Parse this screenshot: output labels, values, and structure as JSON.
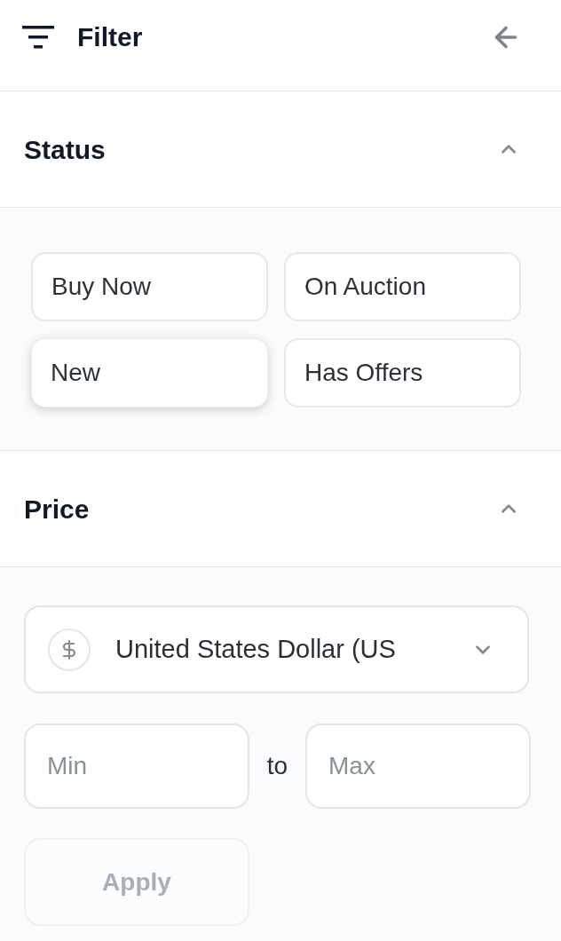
{
  "header": {
    "title": "Filter"
  },
  "sections": [
    {
      "kind": "chips",
      "title": "Status",
      "expanded": true,
      "options": [
        {
          "label": "Buy Now",
          "selected": false
        },
        {
          "label": "On Auction",
          "selected": false
        },
        {
          "label": "New",
          "selected": true
        },
        {
          "label": "Has Offers",
          "selected": false
        }
      ]
    },
    {
      "kind": "price",
      "title": "Price",
      "expanded": true,
      "currency": {
        "value": "United States Dollar (US"
      },
      "min": {
        "placeholder": "Min"
      },
      "separator": "to",
      "max": {
        "placeholder": "Max"
      },
      "apply": {
        "label": "Apply",
        "disabled": true
      }
    }
  ]
}
